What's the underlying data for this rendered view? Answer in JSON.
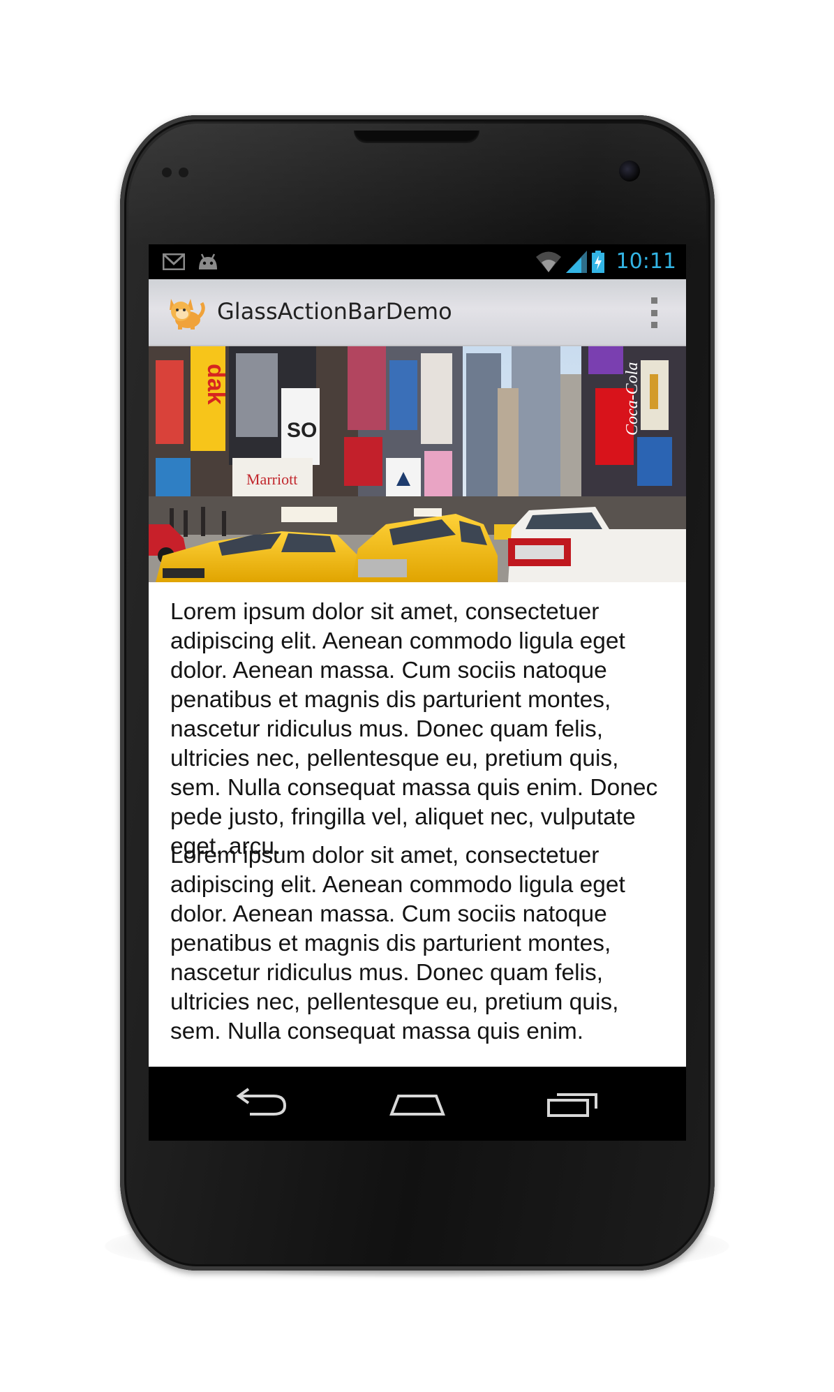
{
  "status_bar": {
    "time": "10:11",
    "notification_icons": [
      "gmail-icon",
      "android-debug-icon"
    ],
    "system_icons": [
      "wifi-icon",
      "signal-icon",
      "battery-charging-icon"
    ],
    "accent_color": "#33b5e5"
  },
  "action_bar": {
    "app_icon": "cat-app-icon",
    "title": "GlassActionBarDemo",
    "overflow_icon": "overflow-menu-icon"
  },
  "hero_image": {
    "description_icon": "times-square-photo"
  },
  "content": {
    "paragraphs": [
      "Lorem ipsum dolor sit amet, consectetuer adipiscing elit. Aenean commodo ligula eget dolor. Aenean massa. Cum sociis natoque penatibus et magnis dis parturient montes, nascetur ridiculus mus. Donec quam felis, ultricies nec, pellentesque eu, pretium quis, sem. Nulla consequat massa quis enim. Donec pede justo, fringilla vel, aliquet nec, vulputate eget, arcu.",
      "Lorem ipsum dolor sit amet, consectetuer adipiscing elit. Aenean commodo ligula eget dolor. Aenean massa. Cum sociis natoque penatibus et magnis dis parturient montes, nascetur ridiculus mus. Donec quam felis, ultricies nec, pellentesque eu, pretium quis, sem. Nulla consequat massa quis enim."
    ]
  },
  "nav_bar": {
    "buttons": [
      "back-icon",
      "home-icon",
      "recent-apps-icon"
    ]
  }
}
